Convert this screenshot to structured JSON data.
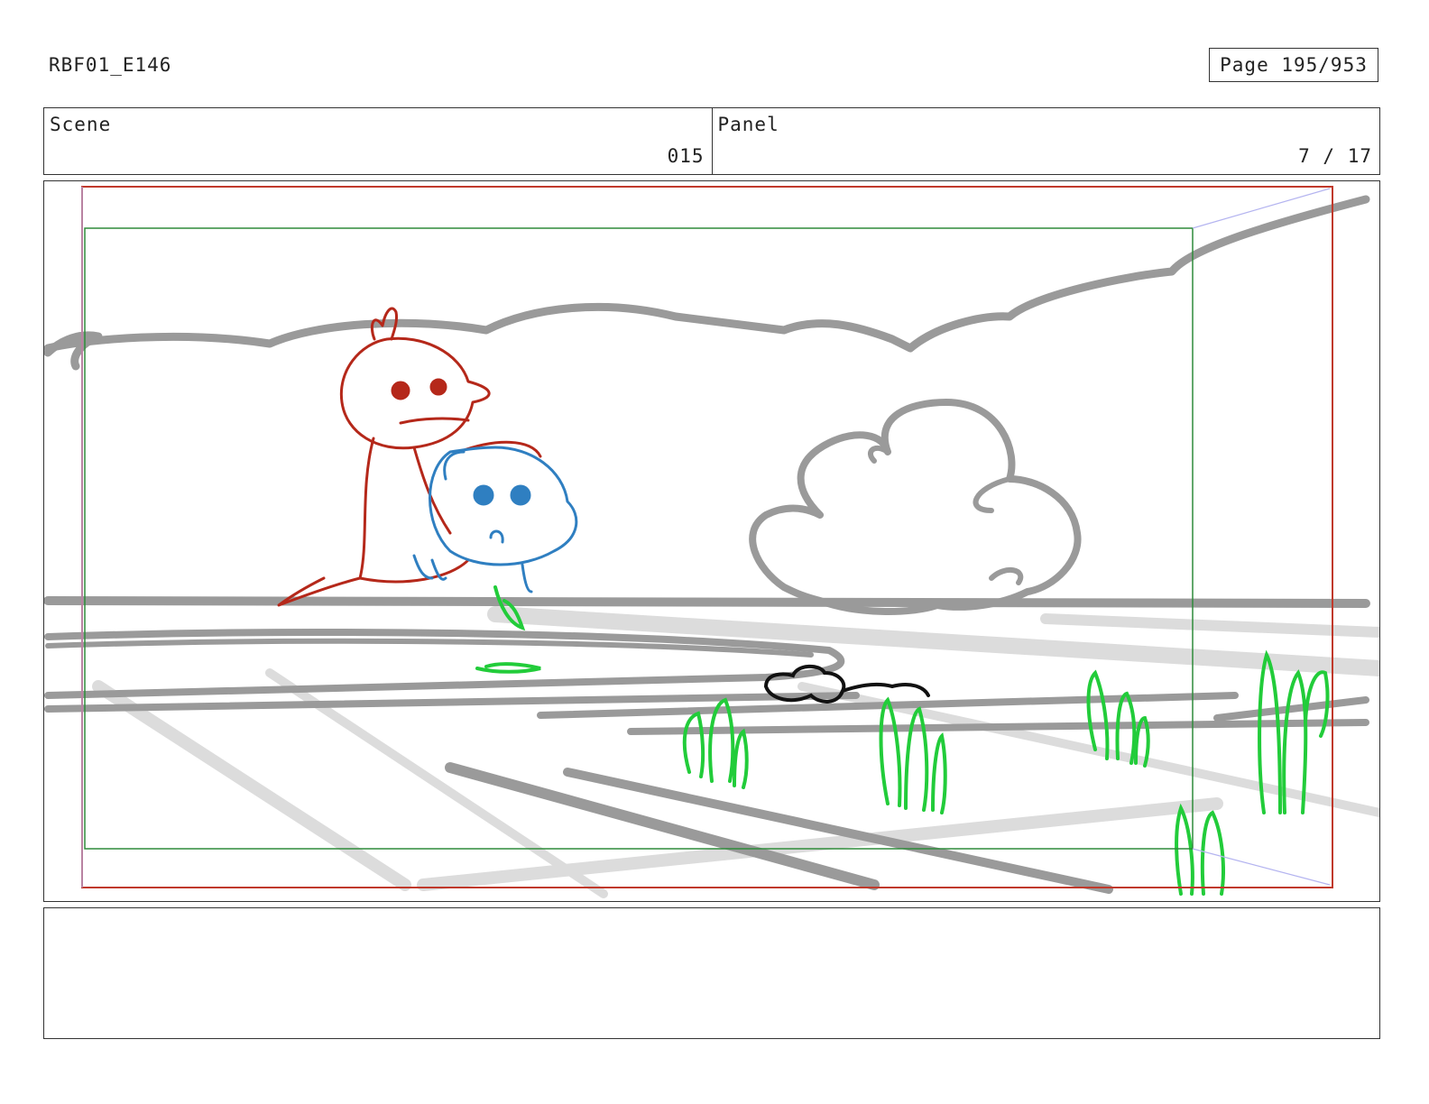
{
  "header": {
    "doc_id": "RBF01_E146",
    "page_label": "Page 195/953"
  },
  "info": {
    "scene_label": "Scene",
    "scene_value": "015",
    "panel_label": "Panel",
    "panel_value": "7 / 17"
  },
  "colors": {
    "safe_frame": "#c0392b",
    "action_frame": "#2e8b3a",
    "scenery": "#9a9a9a",
    "ground_shadow": "#dcdcdc",
    "red_character": "#b5281a",
    "blue_character": "#2f7fc1",
    "grass": "#22cc3a"
  },
  "notes": {
    "text": ""
  }
}
